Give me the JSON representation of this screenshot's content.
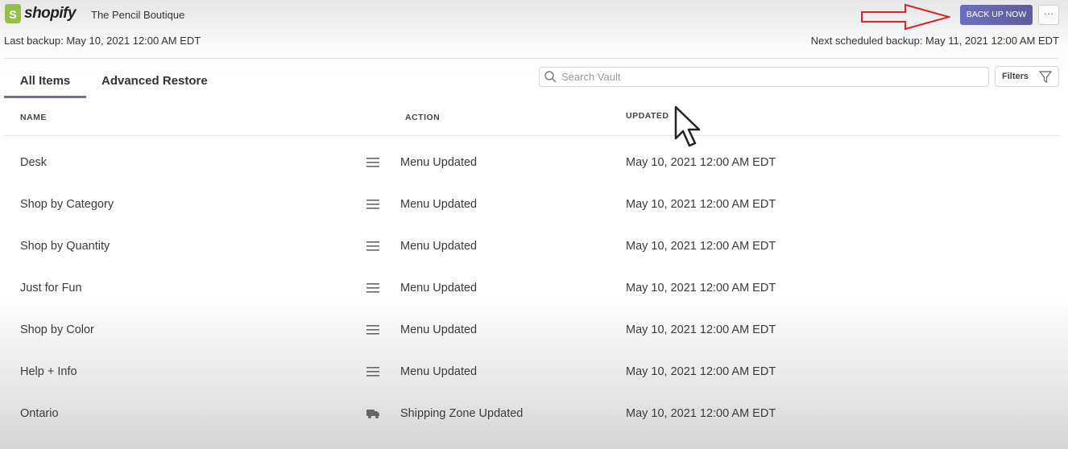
{
  "header": {
    "logo_text": "shopify",
    "store_name": "The Pencil Boutique",
    "last_backup": "Last backup: May 10, 2021 12:00 AM EDT",
    "next_backup": "Next scheduled backup: May 11, 2021 12:00 AM EDT",
    "backup_button": "BACK UP NOW",
    "more_label": "···",
    "accent": "#6c6fc0"
  },
  "tabs": [
    {
      "label": "All Items",
      "active": true
    },
    {
      "label": "Advanced Restore",
      "active": false
    }
  ],
  "search": {
    "placeholder": "Search Vault",
    "value": ""
  },
  "filters_label": "Filters",
  "columns": {
    "name": "NAME",
    "action": "ACTION",
    "updated": "UPDATED"
  },
  "rows": [
    {
      "name": "Desk",
      "icon": "menu-icon",
      "action": "Menu Updated",
      "updated": "May 10, 2021 12:00 AM EDT"
    },
    {
      "name": "Shop by Category",
      "icon": "menu-icon",
      "action": "Menu Updated",
      "updated": "May 10, 2021 12:00 AM EDT"
    },
    {
      "name": "Shop by Quantity",
      "icon": "menu-icon",
      "action": "Menu Updated",
      "updated": "May 10, 2021 12:00 AM EDT"
    },
    {
      "name": "Just for Fun",
      "icon": "menu-icon",
      "action": "Menu Updated",
      "updated": "May 10, 2021 12:00 AM EDT"
    },
    {
      "name": "Shop by Color",
      "icon": "menu-icon",
      "action": "Menu Updated",
      "updated": "May 10, 2021 12:00 AM EDT"
    },
    {
      "name": "Help + Info",
      "icon": "menu-icon",
      "action": "Menu Updated",
      "updated": "May 10, 2021 12:00 AM EDT"
    },
    {
      "name": "Ontario",
      "icon": "truck-icon",
      "action": "Shipping Zone Updated",
      "updated": "May 10, 2021 12:00 AM EDT"
    }
  ]
}
